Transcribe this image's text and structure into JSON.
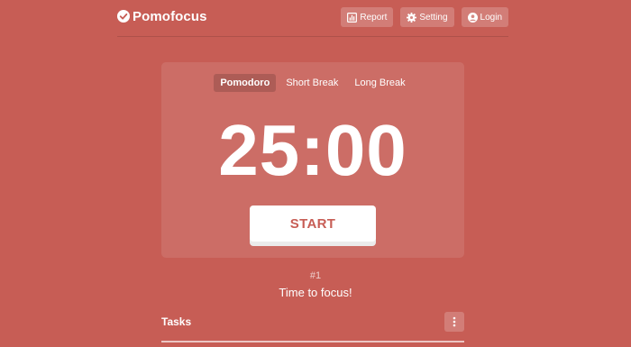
{
  "header": {
    "brand": "Pomofocus",
    "nav": [
      {
        "label": "Report",
        "icon": "report-icon"
      },
      {
        "label": "Setting",
        "icon": "gear-icon"
      },
      {
        "label": "Login",
        "icon": "user-icon"
      }
    ]
  },
  "timer": {
    "modes": [
      "Pomodoro",
      "Short Break",
      "Long Break"
    ],
    "active_mode": "Pomodoro",
    "time": "25:00",
    "start_label": "START"
  },
  "session": {
    "counter": "#1",
    "message": "Time to focus!"
  },
  "tasks": {
    "title": "Tasks",
    "menu_icon": "more-vertical-icon"
  },
  "colors": {
    "background": "#c75d55",
    "accent": "#c75d55",
    "text": "#ffffff"
  }
}
